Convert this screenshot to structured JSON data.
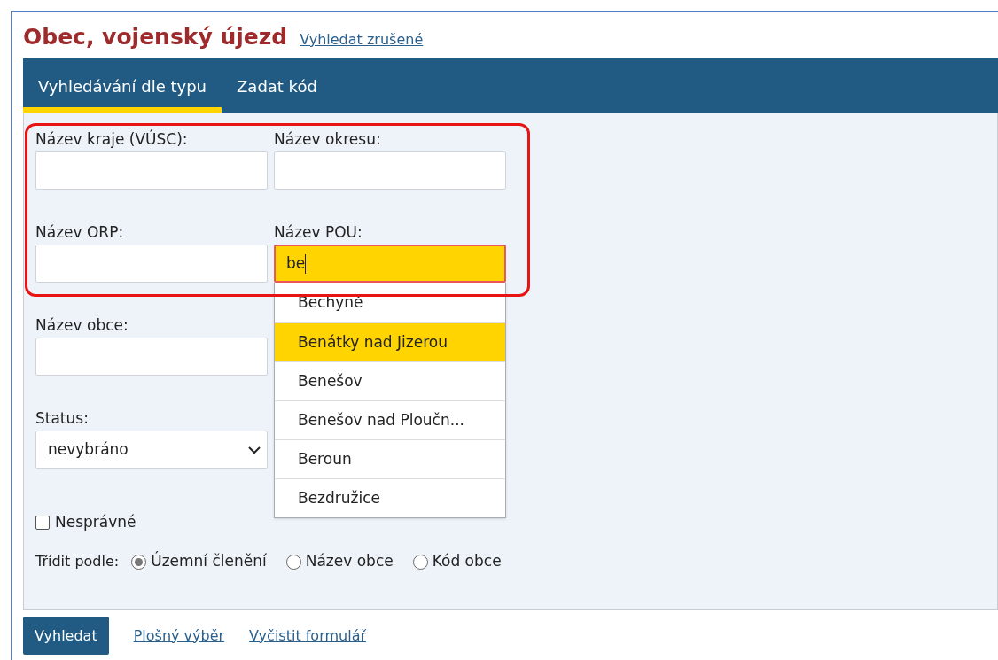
{
  "header": {
    "title": "Obec, vojenský újezd",
    "link": "Vyhledat zrušené"
  },
  "tabs": [
    {
      "label": "Vyhledávání dle typu",
      "selected": true
    },
    {
      "label": "Zadat kód",
      "selected": false
    }
  ],
  "rows": [
    [
      {
        "label": "Název kraje (VÚSC):",
        "kind": "text"
      },
      {
        "label": "Název okresu:",
        "kind": "text"
      }
    ],
    [
      {
        "label": "Název ORP:",
        "kind": "text"
      },
      {
        "label": "Název POU:",
        "kind": "text",
        "value": "be",
        "focused": true,
        "suggestions": [
          {
            "label": "Bechyně",
            "selected": false
          },
          {
            "label": "Benátky nad Jizerou",
            "selected": true
          },
          {
            "label": "Benešov",
            "selected": false
          },
          {
            "label": "Benešov nad Ploučn...",
            "selected": false
          },
          {
            "label": "Beroun",
            "selected": false
          },
          {
            "label": "Bezdružice",
            "selected": false
          }
        ]
      }
    ],
    [
      {
        "label": "Název obce:",
        "kind": "text"
      }
    ],
    [
      {
        "label": "Status:",
        "kind": "select",
        "value": "nevybráno"
      }
    ]
  ],
  "checkbox": {
    "label": "Nesprávné",
    "checked": false
  },
  "sort": {
    "label": "Třídit podle:",
    "options": [
      {
        "label": "Územní členění",
        "selected": true
      },
      {
        "label": "Název obce",
        "selected": false
      },
      {
        "label": "Kód obce",
        "selected": false
      }
    ]
  },
  "actions": {
    "button": "Vyhledat",
    "links": [
      "Plošný výběr",
      "Vyčistit formulář"
    ]
  }
}
